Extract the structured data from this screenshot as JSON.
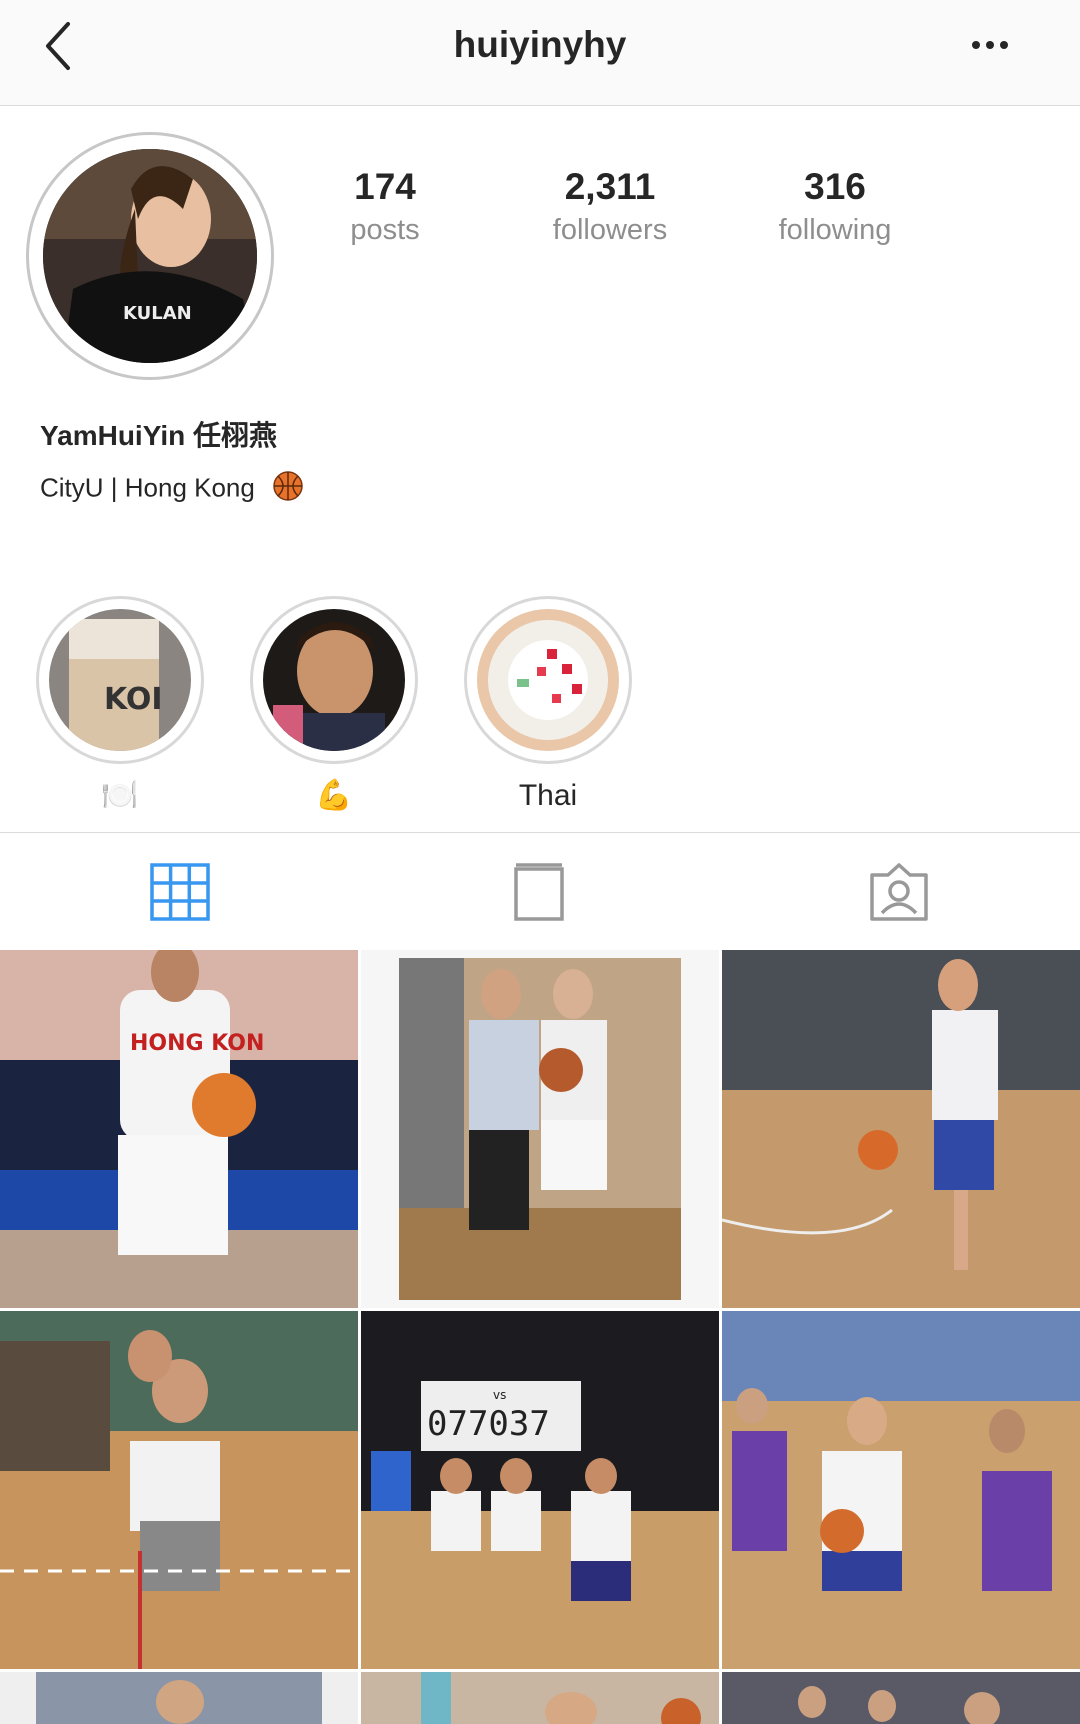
{
  "header": {
    "username": "huiyinyhy",
    "back_icon": "chevron-left-icon",
    "more_icon": "ellipsis-icon"
  },
  "profile": {
    "display_name": "YamHuiYin 任栩燕",
    "bio": "CityU | Hong Kong",
    "bio_emoji": "basketball-icon",
    "stats": [
      {
        "value": "174",
        "label": "posts"
      },
      {
        "value": "2,311",
        "label": "followers"
      },
      {
        "value": "316",
        "label": "following"
      }
    ]
  },
  "highlights": [
    {
      "label": "🍽️",
      "name": "plate-icon"
    },
    {
      "label": "💪",
      "name": "flexed-bicep-icon"
    },
    {
      "label": "Thai",
      "name": "thai"
    }
  ],
  "tabs": [
    {
      "name": "grid-icon",
      "active": true
    },
    {
      "name": "list-icon",
      "active": false
    },
    {
      "name": "tagged-icon",
      "active": false
    }
  ],
  "colors": {
    "accent": "#3897f0",
    "text": "#262626",
    "muted": "#8e8e8e",
    "border": "#dbdbdb"
  }
}
